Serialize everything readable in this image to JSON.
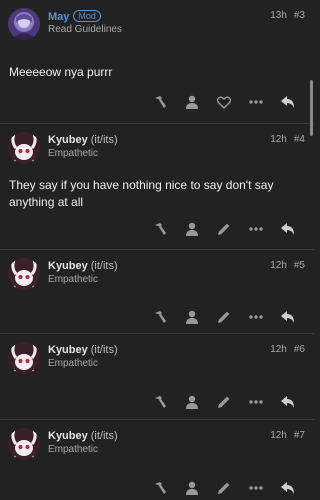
{
  "posts": [
    {
      "username": "May",
      "badge": "Mod",
      "pronouns": "",
      "title": "Read Guidelines",
      "time": "13h",
      "number": "#3",
      "content": "Meeeeow nya purrr",
      "avatar": "purple-anime-avatar",
      "actions": [
        "hammer-icon",
        "person-icon",
        "heart-icon",
        "more-icon",
        "reply-icon"
      ]
    },
    {
      "username": "Kyubey",
      "pronouns": "(it/its)",
      "title": "Empathetic",
      "time": "12h",
      "number": "#4",
      "content": "They say if you have nothing nice to say don't say anything at all",
      "avatar": "kyubey-avatar",
      "actions": [
        "hammer-icon",
        "person-icon",
        "pencil-icon",
        "more-icon",
        "reply-icon"
      ]
    },
    {
      "username": "Kyubey",
      "pronouns": "(it/its)",
      "title": "Empathetic",
      "time": "12h",
      "number": "#5",
      "content": "",
      "avatar": "kyubey-avatar",
      "actions": [
        "hammer-icon",
        "person-icon",
        "pencil-icon",
        "more-icon",
        "reply-icon"
      ]
    },
    {
      "username": "Kyubey",
      "pronouns": "(it/its)",
      "title": "Empathetic",
      "time": "12h",
      "number": "#6",
      "content": "",
      "avatar": "kyubey-avatar",
      "actions": [
        "hammer-icon",
        "person-icon",
        "pencil-icon",
        "more-icon",
        "reply-icon"
      ]
    },
    {
      "username": "Kyubey",
      "pronouns": "(it/its)",
      "title": "Empathetic",
      "time": "12h",
      "number": "#7",
      "content": "",
      "avatar": "kyubey-avatar",
      "actions": [
        "hammer-icon",
        "person-icon",
        "pencil-icon",
        "more-icon",
        "reply-icon"
      ]
    }
  ],
  "colors": {
    "background": "#222222",
    "mod_blue": "#5b8fd6",
    "icon_gray": "#9a9a9a",
    "divider": "#3a3a3a"
  }
}
